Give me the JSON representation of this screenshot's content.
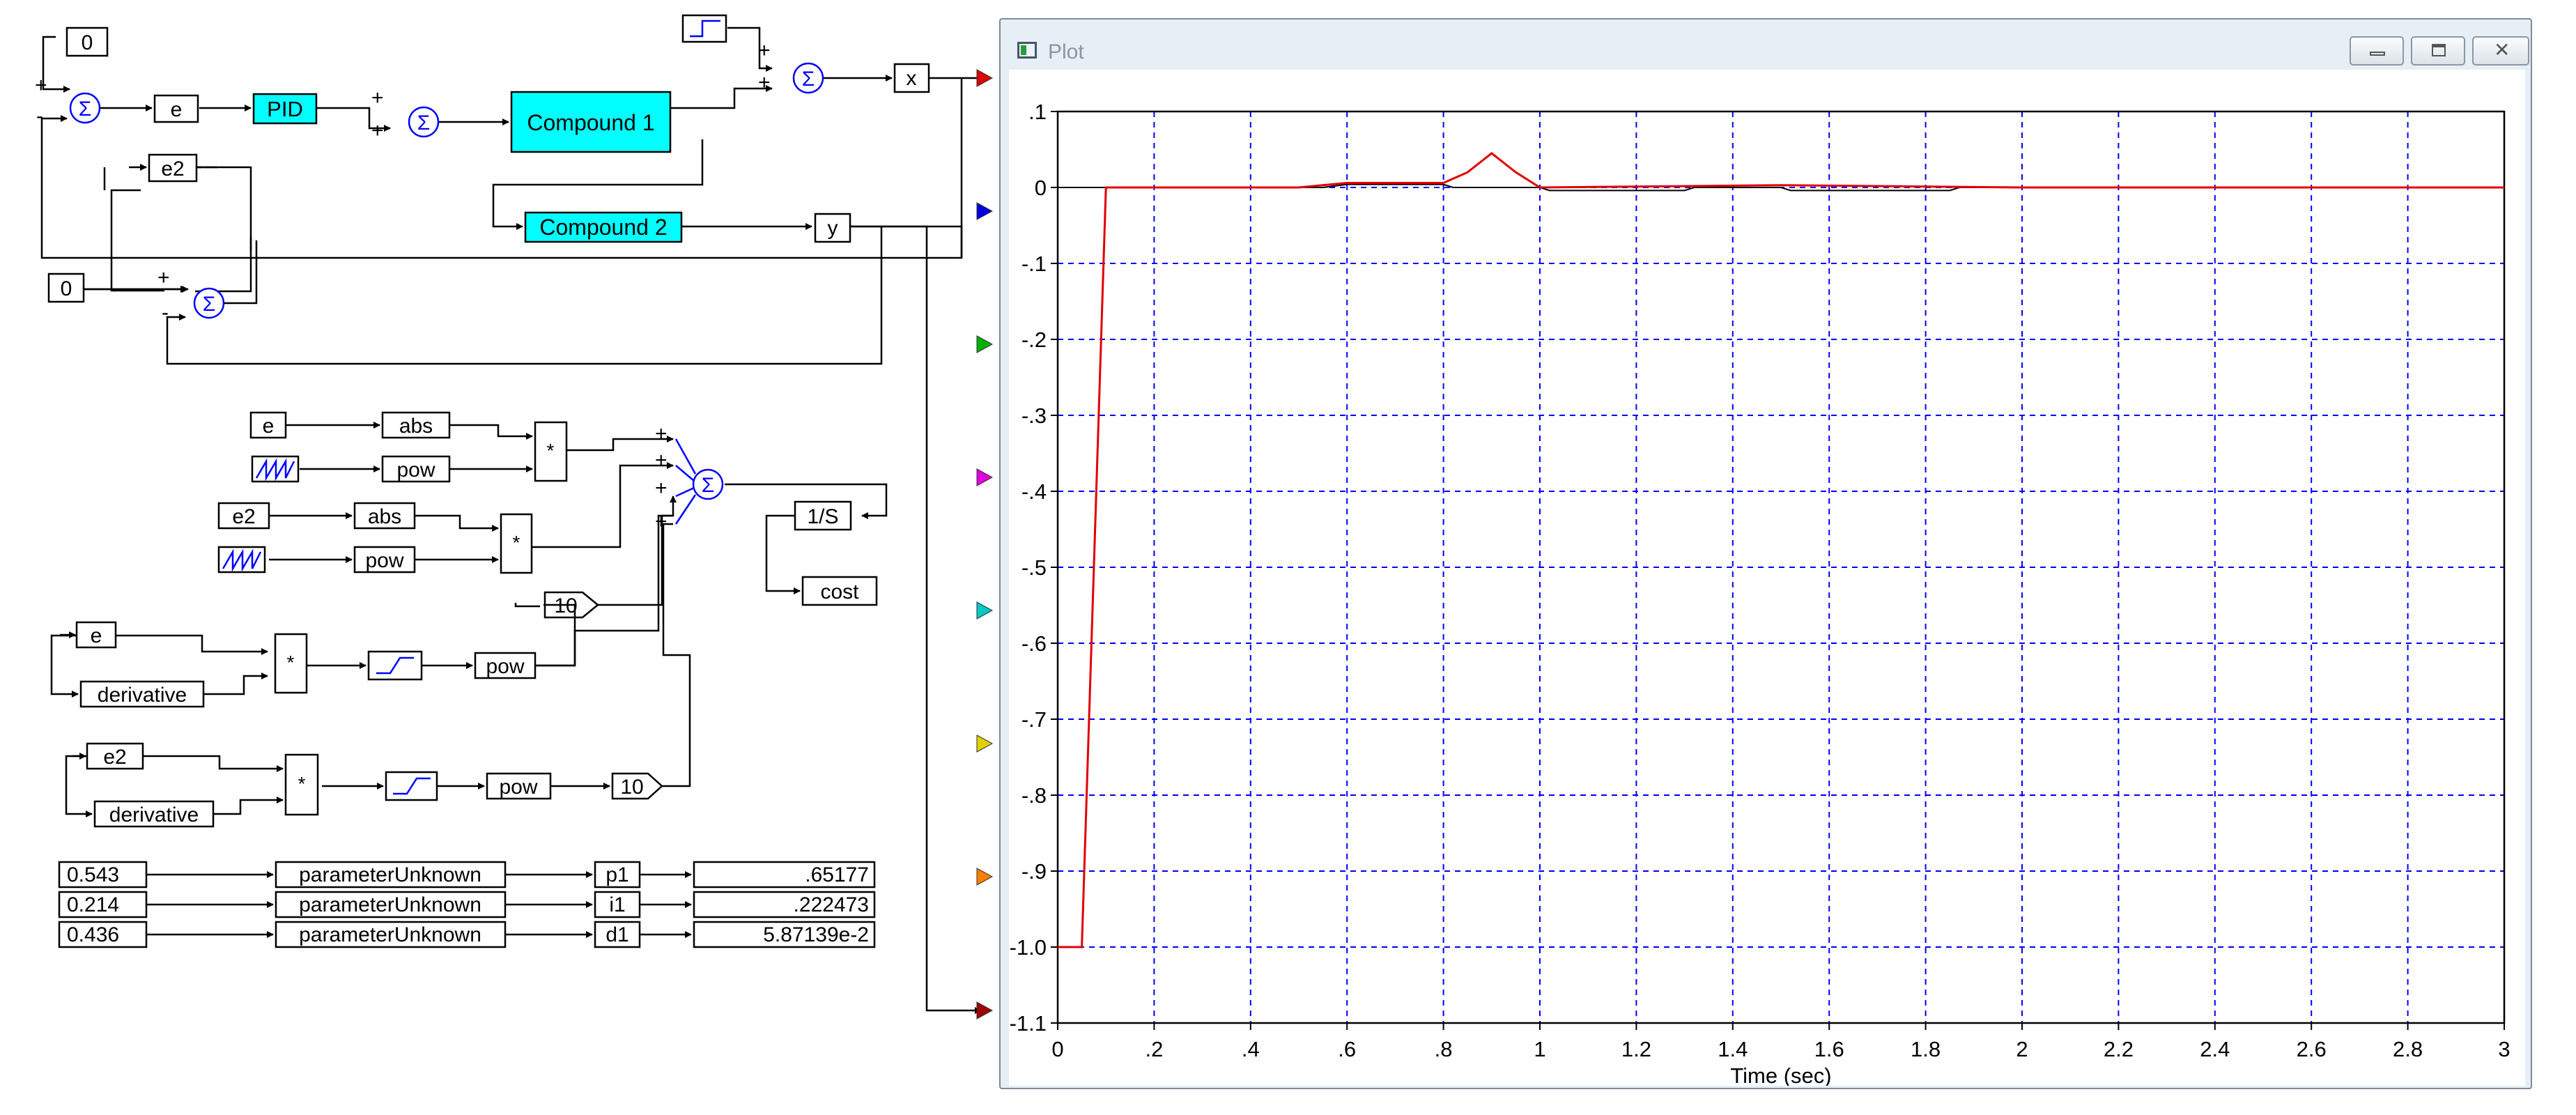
{
  "diagram": {
    "blocks": {
      "const_top": "0",
      "e": "e",
      "pid": "PID",
      "compound1": "Compound 1",
      "compound2": "Compound 2",
      "x": "x",
      "y": "y",
      "e2": "e2",
      "const_mid": "0",
      "cost_e": "e",
      "abs1": "abs",
      "pow1": "pow",
      "mult1": "*",
      "cost_e2": "e2",
      "abs2": "abs",
      "pow2": "pow",
      "mult2": "*",
      "inv_s": "1/S",
      "cost": "cost",
      "deriv_e": "e",
      "derivative1": "derivative",
      "mult3": "*",
      "pow3": "pow",
      "gain3": "10",
      "deriv_e2": "e2",
      "derivative2": "derivative",
      "mult4": "*",
      "pow4": "pow",
      "gain4": "10"
    },
    "signs": {
      "sum_top_a": "+",
      "sum_top_b": "-",
      "sum_pid_a": "+",
      "sum_pid_b": "+",
      "sum_out_a": "+",
      "sum_out_b": "+",
      "sum_mid_a": "+",
      "sum_mid_b": "-",
      "sum_cost_1": "+",
      "sum_cost_2": "+",
      "sum_cost_3": "+",
      "sum_cost_4": "+"
    },
    "parameters": [
      {
        "initial": "0.543",
        "block": "parameterUnknown",
        "name": "p1",
        "display": ".65177"
      },
      {
        "initial": "0.214",
        "block": "parameterUnknown",
        "name": "i1",
        "display": ".222473"
      },
      {
        "initial": "0.436",
        "block": "parameterUnknown",
        "name": "d1",
        "display": "5.87139e-2"
      }
    ],
    "port_colors": [
      "#e00000",
      "#0000e0",
      "#00b000",
      "#e000e0",
      "#00c8c8",
      "#e0d000",
      "#ff8000",
      "#a00000"
    ],
    "sum_symbol": "Σ",
    "block_fill": "#00ffff",
    "line_color": "#000000"
  },
  "plot_window": {
    "title": "Plot",
    "buttons": {
      "minimize": "minimize",
      "maximize": "maximize",
      "close": "close"
    },
    "chart_data": {
      "type": "line",
      "xlabel": "Time (sec)",
      "ylabel": "",
      "xlim": [
        0,
        3
      ],
      "ylim": [
        -1.1,
        0.1
      ],
      "x_ticks": [
        "0",
        ".2",
        ".4",
        ".6",
        ".8",
        "1",
        "1.2",
        "1.4",
        "1.6",
        "1.8",
        "2",
        "2.2",
        "2.4",
        "2.6",
        "2.8",
        "3"
      ],
      "y_ticks": [
        ".1",
        "0",
        "-.1",
        "-.2",
        "-.3",
        "-.4",
        "-.5",
        "-.6",
        "-.7",
        "-.8",
        "-.9",
        "-1.0",
        "-1.1"
      ],
      "grid": true,
      "grid_color": "#0000ff",
      "series": [
        {
          "color": "#e00000",
          "x": [
            0,
            0.05,
            0.1,
            0.5,
            0.6,
            0.8,
            0.85,
            0.9,
            0.95,
            1.0,
            1.5,
            2.0,
            2.5,
            3.0
          ],
          "y": [
            -1.0,
            -1.0,
            0.0,
            0.0,
            0.006,
            0.006,
            0.02,
            0.045,
            0.02,
            0.0,
            0.003,
            0.0,
            0.0,
            0.0
          ]
        },
        {
          "color": "#000000",
          "x": [
            0,
            0.55,
            0.6,
            0.8,
            0.82,
            1.0,
            1.02,
            1.3,
            1.32,
            1.5,
            1.52,
            1.85,
            1.87,
            2.8
          ],
          "y": [
            0.0,
            0.0,
            0.004,
            0.004,
            0.0,
            0.0,
            -0.004,
            -0.004,
            0.0,
            0.0,
            -0.004,
            -0.004,
            0.0,
            0.0
          ]
        }
      ]
    }
  }
}
